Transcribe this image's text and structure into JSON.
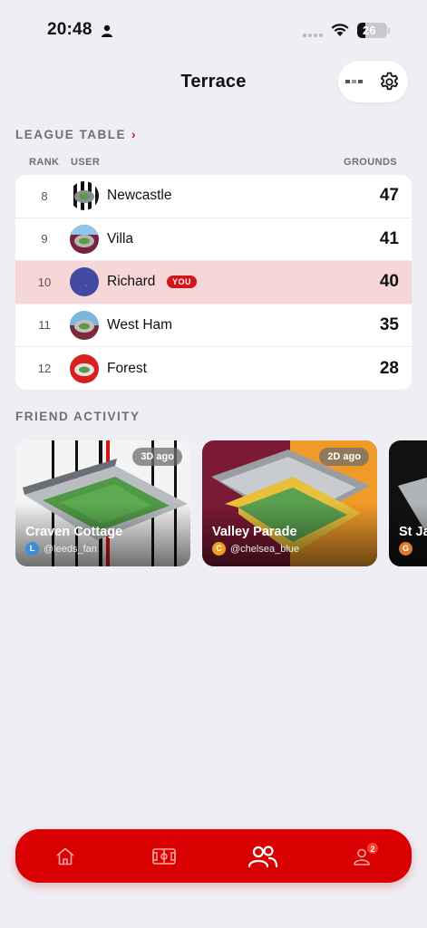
{
  "status_bar": {
    "time": "20:48",
    "battery": 26,
    "battery_label": "26"
  },
  "header": {
    "title": "Terrace",
    "settings_icon": "gear-icon"
  },
  "league": {
    "title": "LEAGUE TABLE",
    "chevron": "›",
    "columns": {
      "rank": "RANK",
      "user": "USER",
      "grounds": "GROUNDS"
    },
    "rows": [
      {
        "rank": "8",
        "name": "Newcastle",
        "grounds": "47"
      },
      {
        "rank": "9",
        "name": "Villa",
        "grounds": "41"
      },
      {
        "rank": "10",
        "name": "Richard",
        "grounds": "40",
        "badge": "YOU"
      },
      {
        "rank": "11",
        "name": "West Ham",
        "grounds": "35"
      },
      {
        "rank": "12",
        "name": "Forest",
        "grounds": "28"
      }
    ]
  },
  "friend_activity": {
    "title": "FRIEND ACTIVITY",
    "cards": [
      {
        "age": "3D ago",
        "title": "Craven Cottage",
        "initial": "L",
        "user": "@leeds_fan",
        "initial_color": "#3a8fd9"
      },
      {
        "age": "2D ago",
        "title": "Valley Parade",
        "initial": "C",
        "user": "@chelsea_blue",
        "initial_color": "#f0a020"
      },
      {
        "age": "",
        "title": "St Ja",
        "initial": "G",
        "user": "",
        "initial_color": "#e0782a"
      }
    ]
  },
  "tabbar": {
    "items": [
      {
        "icon": "home-icon"
      },
      {
        "icon": "pitch-icon"
      },
      {
        "icon": "friends-icon"
      },
      {
        "icon": "profile-icon",
        "badge": "2"
      }
    ]
  },
  "colors": {
    "accent": "#d80000",
    "highlight_row": "#f6d6d7",
    "background": "#efeef4"
  }
}
